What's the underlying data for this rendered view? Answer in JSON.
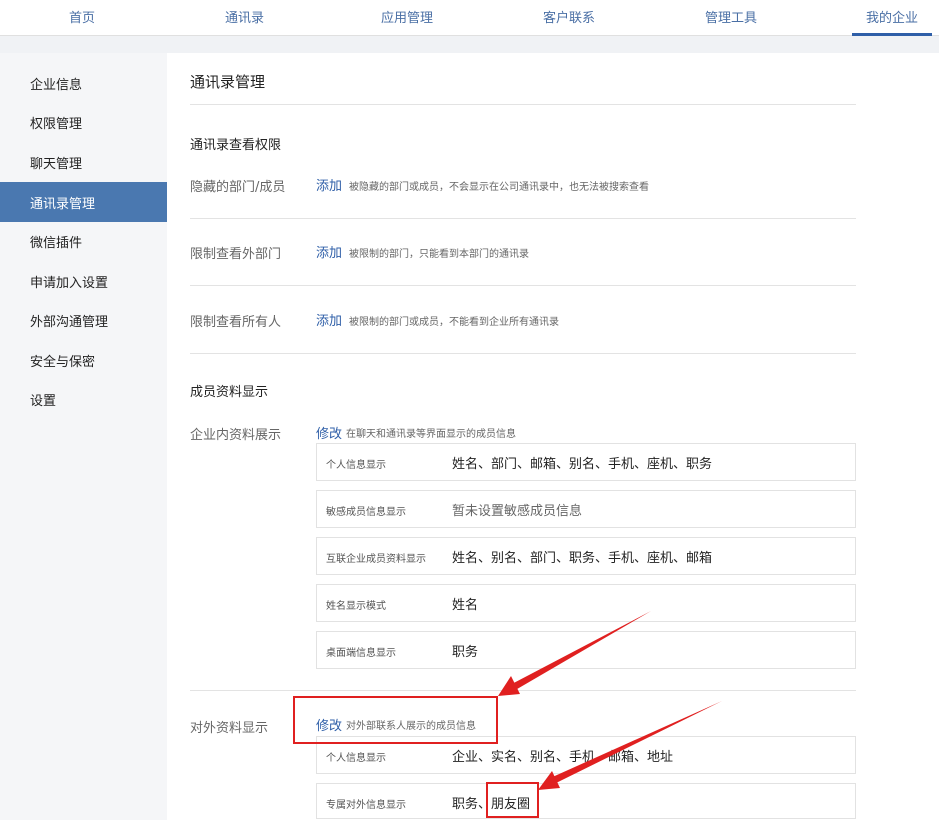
{
  "topnav": {
    "items": [
      "首页",
      "通讯录",
      "应用管理",
      "客户联系",
      "管理工具",
      "我的企业"
    ]
  },
  "sidebar": {
    "items": [
      {
        "label": "企业信息"
      },
      {
        "label": "权限管理"
      },
      {
        "label": "聊天管理"
      },
      {
        "label": "通讯录管理"
      },
      {
        "label": "微信插件"
      },
      {
        "label": "申请加入设置"
      },
      {
        "label": "外部沟通管理"
      },
      {
        "label": "安全与保密"
      },
      {
        "label": "设置"
      }
    ]
  },
  "main": {
    "title": "通讯录管理",
    "view_permission": {
      "title": "通讯录查看权限",
      "rows": [
        {
          "label": "隐藏的部门/成员",
          "action": "添加",
          "desc": "被隐藏的部门或成员，不会显示在公司通讯录中，也无法被搜索查看"
        },
        {
          "label": "限制查看外部门",
          "action": "添加",
          "desc": "被限制的部门，只能看到本部门的通讯录"
        },
        {
          "label": "限制查看所有人",
          "action": "添加",
          "desc": "被限制的部门或成员，不能看到企业所有通讯录"
        }
      ]
    },
    "member_display": {
      "title": "成员资料显示",
      "internal": {
        "label": "企业内资料展示",
        "action": "修改",
        "desc": "在聊天和通讯录等界面显示的成员信息",
        "boxes": [
          {
            "label": "个人信息显示",
            "value": "姓名、部门、邮箱、别名、手机、座机、职务"
          },
          {
            "label": "敏感成员信息显示",
            "value": "暂未设置敏感成员信息"
          },
          {
            "label": "互联企业成员资料显示",
            "value": "姓名、别名、部门、职务、手机、座机、邮箱"
          },
          {
            "label": "姓名显示模式",
            "value": "姓名"
          },
          {
            "label": "桌面端信息显示",
            "value": "职务"
          }
        ]
      },
      "external": {
        "label": "对外资料显示",
        "action": "修改",
        "desc": "对外部联系人展示的成员信息",
        "boxes": [
          {
            "label": "个人信息显示",
            "value": "企业、实名、别名、手机、邮箱、地址"
          },
          {
            "label": "专属对外信息显示",
            "value_prefix": "职务、",
            "value_highlight": "朋友圈"
          }
        ]
      }
    }
  },
  "colors": {
    "accent": "#2f5fa8",
    "sidebar_active": "#4a78b0",
    "annotation_red": "#e02020"
  }
}
